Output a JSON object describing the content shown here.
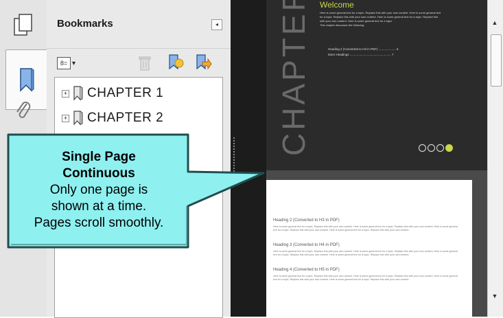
{
  "panel": {
    "title": "Bookmarks",
    "collapse_glyph": "◂"
  },
  "toolbar": {
    "options_icon": "list-options-icon",
    "options_glyph": "8=",
    "dropdown_glyph": "▾"
  },
  "bookmarks": [
    {
      "label": "CHAPTER 1",
      "expander": "+"
    },
    {
      "label": "CHAPTER 2",
      "expander": "+"
    }
  ],
  "callout": {
    "title_line1": "Single Page",
    "title_line2": "Continuous",
    "line1": "Only one page is",
    "line2": "shown at a time.",
    "line3": "Pages scroll smoothly."
  },
  "document": {
    "chapter_word": "CHAPTER",
    "welcome": "Welcome",
    "intro": "Here is some general text for a topic. Replace this with your own content. Here is some general text for a topic. Replace this with your own content. Here is some general text for a topic. Replace this with your own content. Here is some general text for a topic.",
    "intro2": "This chapter discusses the following:",
    "toc": [
      "Heading 2 (Converted to H3 in PDF) .................... 6",
      "More Headings ................................................ 7"
    ],
    "headings": [
      "Heading 2 (Converted to H3 in PDF)",
      "Heading 3 (Converted to H4 in PDF)",
      "Heading 4 (Converted to H5 in PDF)"
    ],
    "body": "Here is some general text for a topic. Replace this with your own content. Here is some general text for a topic. Replace this with your own content. Here is some general text for a topic. Replace this with your own content. Here is some general text for a topic. Replace this with your own content."
  },
  "scrollbar": {
    "up": "▲",
    "down": "▼"
  },
  "colors": {
    "callout_fill": "#8ff0f0",
    "callout_border": "#1f4e4e",
    "accent": "#c9d84a"
  }
}
